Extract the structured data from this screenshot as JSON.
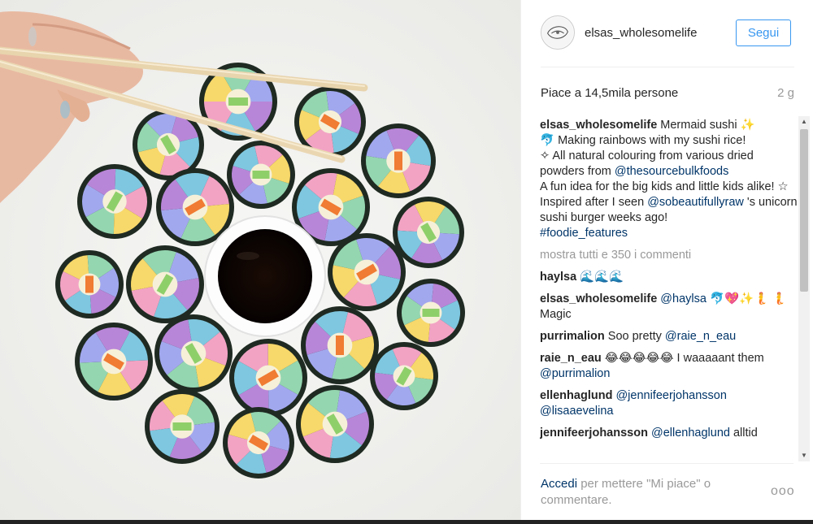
{
  "post": {
    "username": "elsas_wholesomelife",
    "follow_label": "Segui",
    "likes_text": "Piace a 14,5mila persone",
    "time_ago": "2 g"
  },
  "caption": {
    "username": "elsas_wholesomelife",
    "line1": " Mermaid sushi ✨",
    "line2": "🐬 Making rainbows with my sushi rice!",
    "line3": "✧ All natural colouring from various dried powders from ",
    "mention1": "@thesourcebulkfoods",
    "line4": "A fun idea for the big kids and little kids alike! ☆",
    "line5": "Inspired after I seen ",
    "mention2": "@sobeautifullyraw",
    "line6": " 's unicorn sushi burger weeks ago!",
    "hashtag": "#foodie_features"
  },
  "show_all_comments": "mostra tutti e 350 i commenti",
  "comments": [
    {
      "user": "haylsa",
      "text": " 🌊🌊🌊"
    },
    {
      "user": "elsas_wholesomelife",
      "mention": "@haylsa",
      "text": " 🐬💖✨🧜 🧜 Magic"
    },
    {
      "user": "purrimalion",
      "text": " Soo pretty ",
      "mention": "@raie_n_eau"
    },
    {
      "user": "raie_n_eau",
      "text": " 😂😂😂😂😂 I waaaaant them ",
      "mention": "@purrimalion"
    },
    {
      "user": "ellenhaglund",
      "mention": "@jennifeerjohansson",
      "mention2": "@lisaaevelina"
    },
    {
      "user": "jennifeerjohansson",
      "mention": "@ellenhaglund",
      "text": " alltid"
    }
  ],
  "footer": {
    "login_label": "Accedi",
    "rest": " per mettere \"Mi piace\" o commentare.",
    "more_label": "ooo"
  },
  "icons": {
    "more": "more-options-icon",
    "scroll_up": "scroll-up-icon",
    "scroll_down": "scroll-down-icon"
  }
}
